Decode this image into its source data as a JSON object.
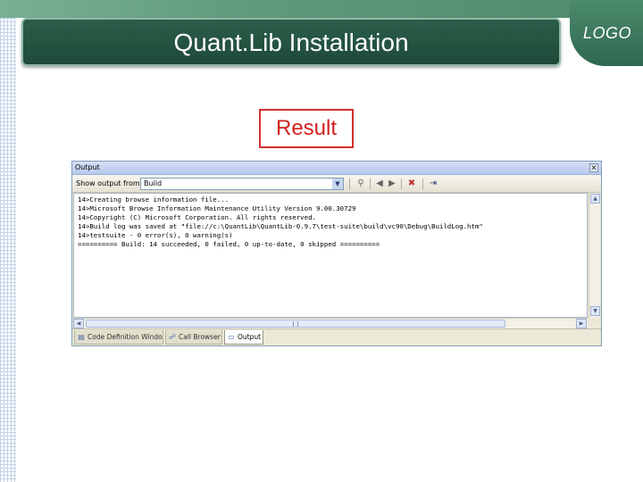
{
  "slide": {
    "title": "Quant.Lib Installation",
    "logo": "LOGO",
    "result_label": "Result"
  },
  "window": {
    "title": "Output",
    "close_glyph": "✕",
    "toolbar": {
      "show_output_label": "Show output from:",
      "source_value": "Build"
    },
    "output_lines": [
      "14>Creating browse information file...",
      "14>Microsoft Browse Information Maintenance Utility Version 9.00.30729",
      "14>Copyright (C) Microsoft Corporation. All rights reserved.",
      "14>Build log was saved at \"file://c:\\QuantLib\\QuantLib-0.9.7\\test-suite\\build\\vc90\\Debug\\BuildLog.htm\"",
      "14>testsuite - 0 error(s), 0 warning(s)",
      "========== Build: 14 succeeded, 0 failed, 0 up-to-date, 0 skipped =========="
    ],
    "tabs": [
      {
        "label": "Code Definition Window",
        "icon": "code-definition-icon",
        "active": false
      },
      {
        "label": "Call Browser",
        "icon": "call-browser-icon",
        "active": false
      },
      {
        "label": "Output",
        "icon": "output-icon",
        "active": true
      }
    ]
  },
  "colors": {
    "title_bar": "#1f4a39",
    "accent_green": "#5f9a7c",
    "result_border": "#d03030",
    "result_text": "#d02020"
  }
}
